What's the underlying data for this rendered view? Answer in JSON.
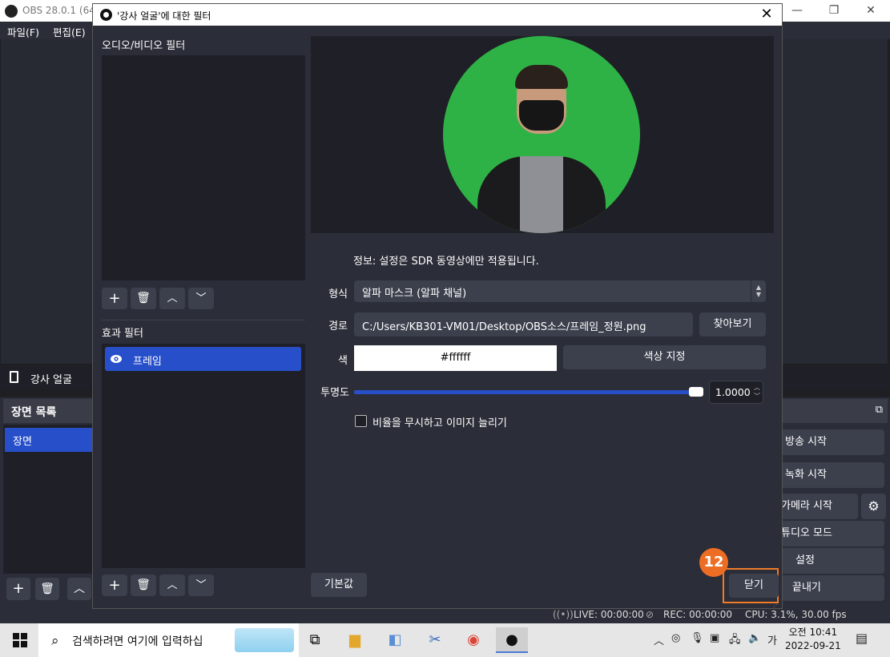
{
  "main_window": {
    "title": "OBS 28.0.1 (64-",
    "menu": [
      "파일(F)",
      "편집(E)"
    ],
    "source_name": "강사 얼굴",
    "scene_dock_title": "장면 목록",
    "scenes": [
      "장면"
    ],
    "controls": [
      "방송 시작",
      "녹화 시작",
      "가메라 시작",
      "튜디오 모드",
      "설정",
      "끝내기"
    ],
    "status": {
      "live": "LIVE: 00:00:00",
      "rec": "REC: 00:00:00",
      "cpu": "CPU: 3.1%, 30.00 fps"
    }
  },
  "dialog": {
    "title": "'강사 얼굴'에 대한 필터",
    "av_filters_label": "오디오/비디오 필터",
    "effect_filters_label": "효과 필터",
    "effect_filters": [
      "프레임"
    ],
    "info_text": "정보: 설정은 SDR 동영상에만 적용됩니다.",
    "type_label": "형식",
    "type_value": "알파 마스크 (알파 채널)",
    "path_label": "경로",
    "path_value": "C:/Users/KB301-VM01/Desktop/OBS소스/프레임_정원.png",
    "browse_button": "찾아보기",
    "color_label": "색",
    "color_value": "#ffffff",
    "color_button": "색상 지정",
    "opacity_label": "투명도",
    "opacity_value": "1.0000",
    "stretch_label": "비율을 무시하고 이미지 늘리기",
    "stretch_checked": false,
    "default_button": "기본값",
    "close_button": "닫기",
    "step_badge": "12",
    "badge_color": "#ee6d24",
    "accent_color": "#284fca"
  },
  "taskbar": {
    "search_placeholder": "검색하려면 여기에 입력하십",
    "time": "오전 10:41",
    "date": "2022-09-21",
    "ime": "가"
  }
}
